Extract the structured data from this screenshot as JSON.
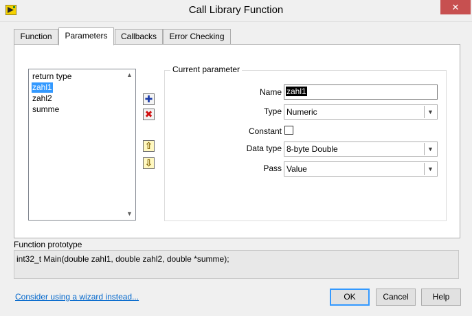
{
  "window": {
    "title": "Call Library Function",
    "close_glyph": "✕"
  },
  "tabs": [
    {
      "label": "Function"
    },
    {
      "label": "Parameters",
      "active": true
    },
    {
      "label": "Callbacks"
    },
    {
      "label": "Error Checking"
    }
  ],
  "parameters": {
    "items": [
      "return type",
      "zahl1",
      "zahl2",
      "summe"
    ],
    "selected": "zahl1"
  },
  "side_buttons": {
    "add_glyph": "✚",
    "delete_glyph": "✖",
    "up_glyph": "⇧",
    "down_glyph": "⇩"
  },
  "current_parameter": {
    "legend": "Current parameter",
    "name_label": "Name",
    "name_value": "zahl1",
    "type_label": "Type",
    "type_value": "Numeric",
    "constant_label": "Constant",
    "constant_checked": false,
    "data_type_label": "Data type",
    "data_type_value": "8-byte Double",
    "pass_label": "Pass",
    "pass_value": "Value"
  },
  "prototype": {
    "label": "Function prototype",
    "text": "int32_t Main(double zahl1, double zahl2, double *summe);"
  },
  "footer": {
    "wizard_link": "Consider using a wizard instead...",
    "ok_label": "OK",
    "cancel_label": "Cancel",
    "help_label": "Help"
  },
  "colors": {
    "selection": "#3399ff",
    "link": "#0066cc",
    "close": "#c75050"
  }
}
